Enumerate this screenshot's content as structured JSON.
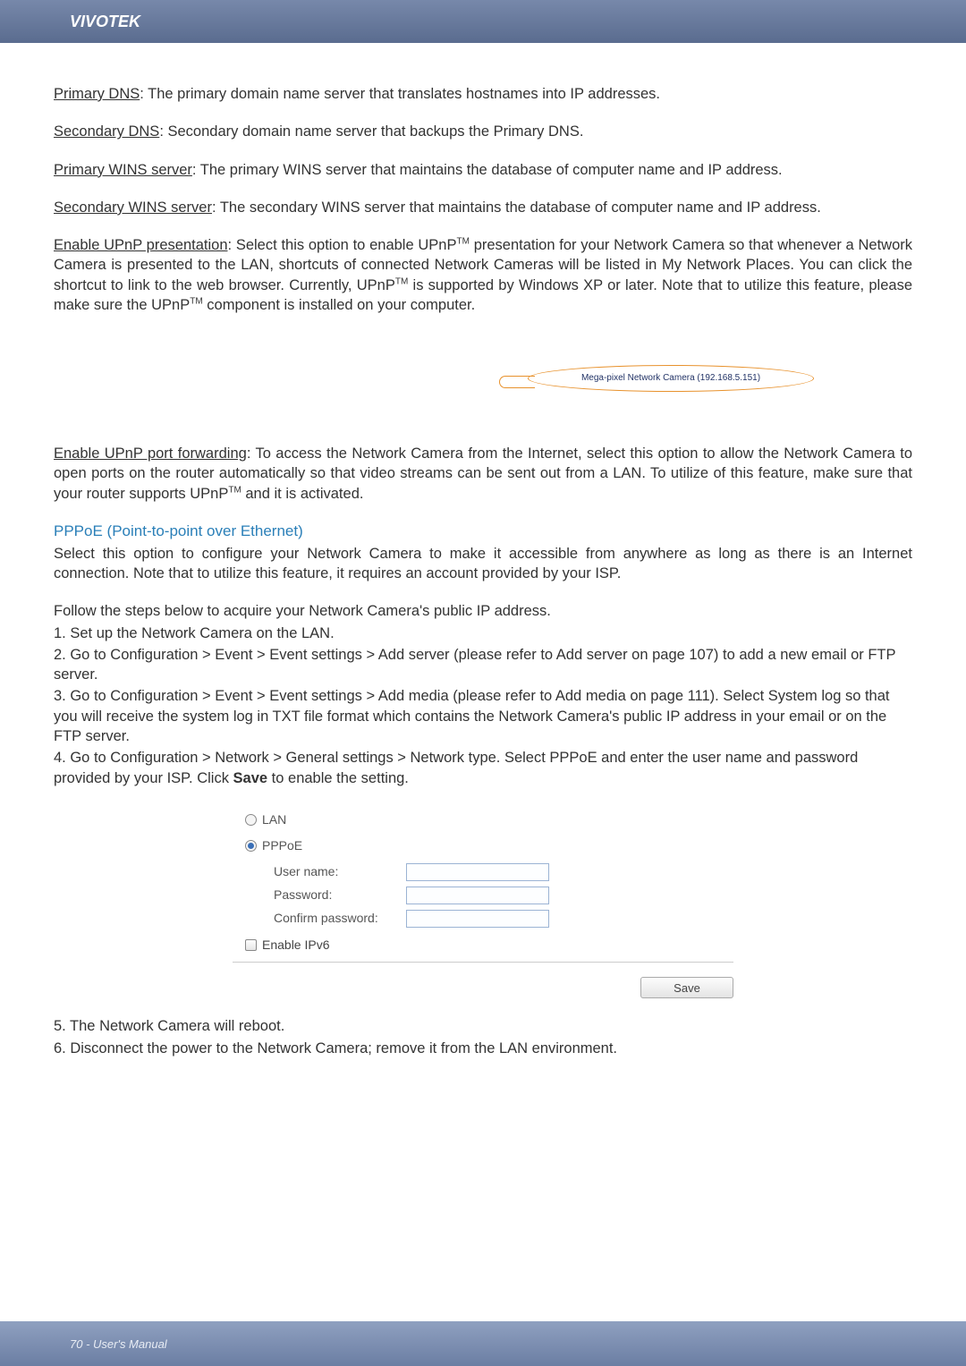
{
  "header": {
    "brand": "VIVOTEK"
  },
  "body": {
    "p1_term": "Primary DNS",
    "p1_rest": ": The primary domain name server that translates hostnames into IP addresses.",
    "p2_term": "Secondary DNS",
    "p2_rest": ": Secondary domain name server that backups the Primary DNS.",
    "p3_term": "Primary WINS server",
    "p3_rest": ": The primary WINS server that maintains the database of computer name and IP address.",
    "p4_term": "Secondary WINS server",
    "p4_rest": ": The secondary WINS server that maintains the database of computer name and IP address.",
    "p5_term": "Enable UPnP presentation",
    "p5_a": ": Select this option to enable UPnP",
    "p5_b": " presentation for your Network Camera so that whenever a Network Camera is presented to the LAN, shortcuts of connected Network Cameras will be listed in My Network Places. You can click the shortcut to link to the web browser. Currently, UPnP",
    "p5_c": " is supported by Windows XP or later. Note that to utilize this feature, please make sure the UPnP",
    "p5_d": " component is installed on your computer.",
    "tm": "TM",
    "callout_text": "Mega-pixel Network Camera (192.168.5.151)",
    "p6_term": "Enable UPnP port forwarding",
    "p6_a": ": To access the Network Camera from the Internet, select this option to allow the Network Camera to open ports on the router automatically so that video streams can be sent out from a LAN. To utilize of this feature, make sure that your router supports UPnP",
    "p6_b": " and it is activated.",
    "section_title": "PPPoE (Point-to-point over Ethernet)",
    "p7": "Select this option to configure your Network Camera to make it accessible from anywhere as long as there is an Internet connection. Note that to utilize this feature, it requires an account provided by your ISP.",
    "p8": "Follow the steps below to acquire your Network Camera's public IP address.",
    "l1": "1. Set up the Network Camera on the LAN.",
    "l2": "2. Go to Configuration > Event > Event settings > Add server (please refer to Add server on page 107) to add a new email or FTP server.",
    "l3": "3. Go to Configuration > Event > Event settings > Add media (please refer to Add media on page 111). Select System log so that you will receive the system log in TXT file format which contains the Network Camera's public IP address in your email or on the FTP server.",
    "l4a": "4. Go to Configuration > Network > General settings > Network type. Select PPPoE and enter the user name and password provided by your ISP. Click ",
    "l4b": "Save",
    "l4c": " to enable the setting.",
    "p9": "5. The Network Camera will reboot.",
    "p10": "6. Disconnect the power to the Network Camera; remove it from the LAN environment."
  },
  "form": {
    "lan_label": "LAN",
    "pppoe_label": "PPPoE",
    "user_name": "User name:",
    "password": "Password:",
    "confirm": "Confirm password:",
    "ipv6": "Enable IPv6",
    "save": "Save"
  },
  "footer": {
    "text": "70 - User's Manual"
  }
}
